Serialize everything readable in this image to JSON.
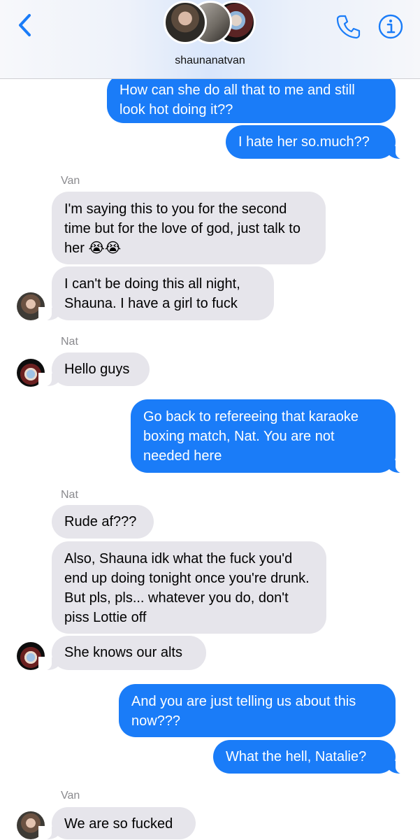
{
  "header": {
    "group_name": "shaunanatvan",
    "back_icon": "chevron-left-icon",
    "call_icon": "phone-icon",
    "info_icon": "info-icon",
    "accent_color": "#1a7cf8"
  },
  "messages": [
    {
      "direction": "out",
      "text": "How can she do all that to me and still look hot doing it??"
    },
    {
      "direction": "out",
      "text": "I hate her so.much??"
    },
    {
      "direction": "label",
      "text": "Van"
    },
    {
      "direction": "in",
      "sender": "Van",
      "text": "I'm saying this to you for the second time but for the love of god, just talk to her 😭😭"
    },
    {
      "direction": "in",
      "sender": "Van",
      "text": "I can't be doing this all night, Shauna. I have a girl to fuck"
    },
    {
      "direction": "label",
      "text": "Nat"
    },
    {
      "direction": "in",
      "sender": "Nat",
      "text": "Hello guys"
    },
    {
      "direction": "out",
      "text": "Go back to refereeing that karaoke boxing match, Nat. You are not needed here"
    },
    {
      "direction": "label",
      "text": "Nat"
    },
    {
      "direction": "in",
      "sender": "Nat",
      "text": "Rude af???"
    },
    {
      "direction": "in",
      "sender": "Nat",
      "text": "Also, Shauna idk what the fuck you'd end up doing tonight once you're drunk. But pls, pls... whatever you do, don't piss Lottie off"
    },
    {
      "direction": "in",
      "sender": "Nat",
      "text": "She knows our alts"
    },
    {
      "direction": "out",
      "text": "And you are just telling us about this now???"
    },
    {
      "direction": "out",
      "text": "What the hell, Natalie?"
    },
    {
      "direction": "label",
      "text": "Van"
    },
    {
      "direction": "in",
      "sender": "Van",
      "text": "We are so fucked"
    }
  ]
}
